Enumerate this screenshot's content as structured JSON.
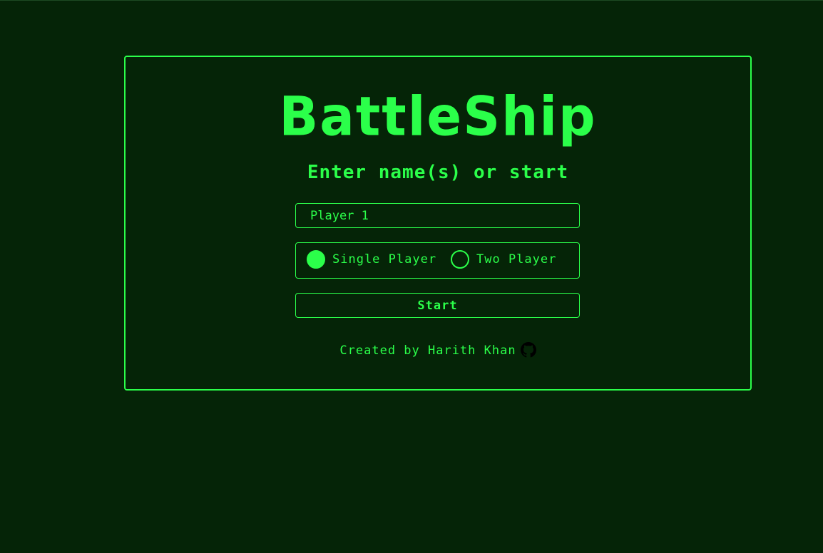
{
  "app": {
    "title": "BattleShip",
    "subtitle": "Enter name(s) or start"
  },
  "form": {
    "player1_placeholder": "Player 1",
    "player1_value": "",
    "modes": [
      {
        "label": "Single Player",
        "selected": true
      },
      {
        "label": "Two Player",
        "selected": false
      }
    ],
    "start_label": "Start"
  },
  "footer": {
    "credit": "Created by Harith Khan",
    "icon": "github-icon"
  },
  "colors": {
    "background": "#052407",
    "accent": "#2bff4a"
  }
}
